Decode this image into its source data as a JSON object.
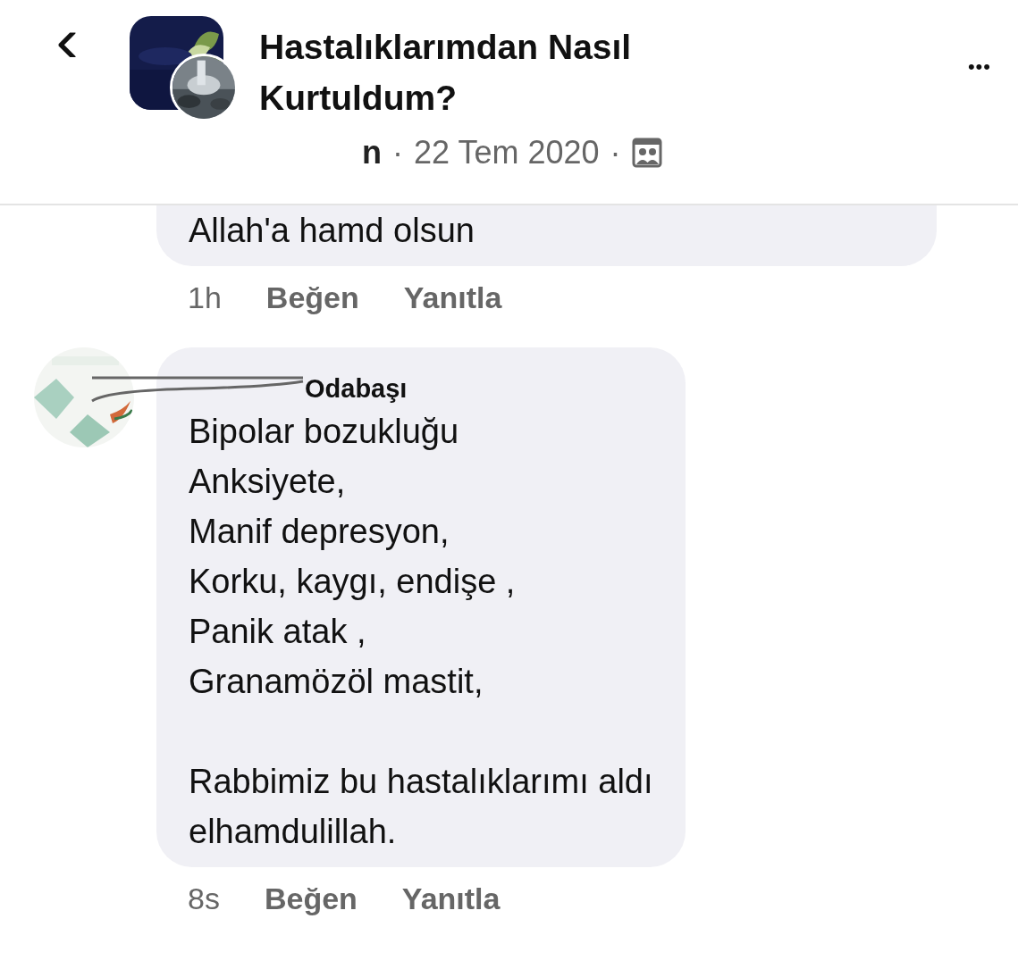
{
  "header": {
    "back": "‹",
    "title": "Hastalıklarımdan Nasıl Kurtuldum?",
    "author": "n",
    "separator_1": "·",
    "date": "22 Tem 2020",
    "separator_2": "·",
    "more": "•••"
  },
  "comments": [
    {
      "kind": "continued",
      "body": "Allah'a hamd olsun",
      "time": "1h",
      "like": "Beğen",
      "reply": "Yanıtla"
    },
    {
      "name": "Odabaşı",
      "body": "Bipolar bozukluğu\nAnksiyete,\nManif depresyon,\nKorku, kaygı, endişe ,\nPanik atak ,\nGranamözöl mastit,\n\nRabbimiz bu hastalıklarımı aldı\nelhamdulillah.",
      "time": "8s",
      "like": "Beğen",
      "reply": "Yanıtla",
      "kind": "full"
    }
  ]
}
